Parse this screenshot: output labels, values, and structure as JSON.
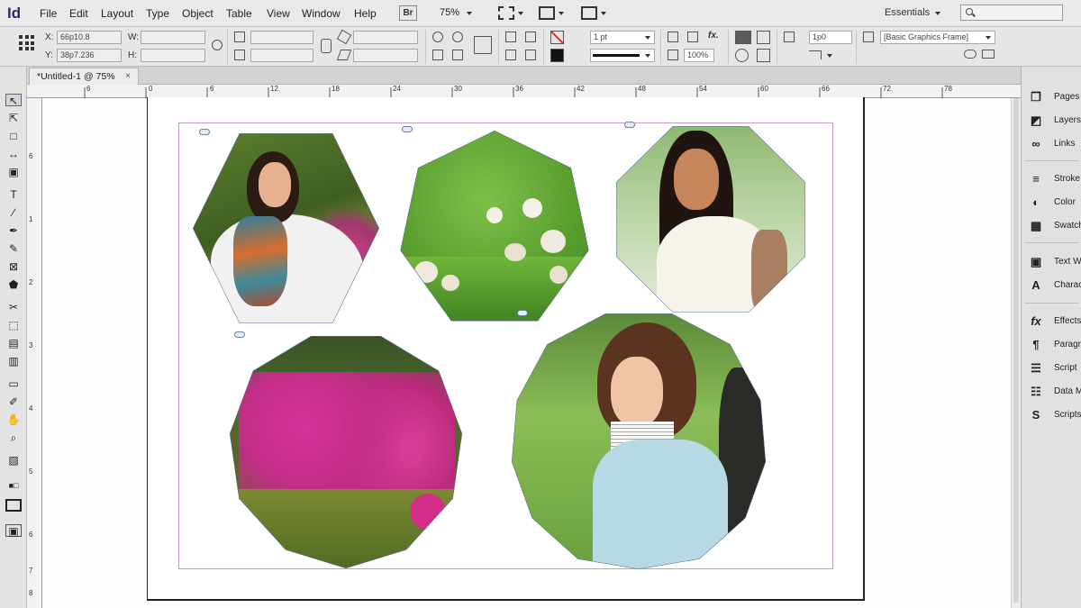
{
  "app": {
    "logo": "Id"
  },
  "menu": {
    "items": [
      "File",
      "Edit",
      "Layout",
      "Type",
      "Object",
      "Table",
      "View",
      "Window",
      "Help"
    ],
    "bridge_label": "Br",
    "zoom": "75%",
    "workspace": "Essentials"
  },
  "control_panel": {
    "x_label": "X:",
    "x_value": "66p10.8",
    "y_label": "Y:",
    "y_value": "38p7.236",
    "w_label": "W:",
    "h_label": "H:",
    "stroke_weight": "1 pt",
    "scale_percent": "100%",
    "fx_label": "fx.",
    "corner_size": "1p0",
    "object_style": "[Basic Graphics Frame]"
  },
  "document": {
    "tab_title": "*Untitled-1 @ 75%",
    "tab_close": "×",
    "ruler_top": [
      "6",
      "0",
      "6",
      "12",
      "18",
      "24",
      "30",
      "36",
      "42",
      "48",
      "54",
      "60",
      "66",
      "72",
      "78"
    ],
    "ruler_left": [
      "6",
      "1",
      "2",
      "3",
      "4",
      "5",
      "6",
      "7",
      "8"
    ]
  },
  "frames": [
    {
      "id": "hexagon-portrait",
      "shape": "hexagon",
      "subject": "woman with scarf"
    },
    {
      "id": "heptagon-flowers",
      "shape": "heptagon",
      "subject": "white flowers"
    },
    {
      "id": "octagon-portrait",
      "shape": "octagon",
      "subject": "smiling woman"
    },
    {
      "id": "decagon-flowers",
      "shape": "decagon",
      "subject": "pink flowers"
    },
    {
      "id": "dodecagon-portrait",
      "shape": "dodecagon",
      "subject": "woman in blue sweater"
    }
  ],
  "panels": [
    "Pages",
    "Layers",
    "Links",
    "Stroke",
    "Color",
    "Swatches",
    "Text Wrap",
    "Character",
    "Effects",
    "Paragraph",
    "Script",
    "Data Merge",
    "Scripts"
  ],
  "colors": {
    "page_border": "#222222",
    "margin_guide": "#c19ac7",
    "frame_edge": "#5e6f9c",
    "ui_chrome": "#e6e6e6"
  }
}
